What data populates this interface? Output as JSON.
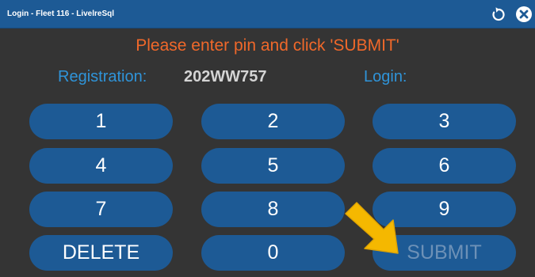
{
  "window": {
    "title": "Login - Fleet 116 - LivelreSql",
    "refresh_icon": "refresh-icon",
    "close_icon": "close-icon"
  },
  "instruction": "Please enter pin and click 'SUBMIT'",
  "registration": {
    "label": "Registration:",
    "value": "202WW757"
  },
  "login": {
    "label": "Login:",
    "value": ""
  },
  "keypad": {
    "k1": "1",
    "k2": "2",
    "k3": "3",
    "k4": "4",
    "k5": "5",
    "k6": "6",
    "k7": "7",
    "k8": "8",
    "k9": "9",
    "delete": "DELETE",
    "k0": "0",
    "submit": "SUBMIT"
  },
  "colors": {
    "title_bar": "#1d5a95",
    "dialog_bg": "#343434",
    "instruction": "#f0682a",
    "label": "#2f94d9",
    "key_bg": "#1d5a95",
    "submit_disabled_text": "#6d91b7",
    "highlight_arrow": "#f5b800"
  },
  "annotation": {
    "arrow_icon": "pointer-arrow-icon"
  }
}
